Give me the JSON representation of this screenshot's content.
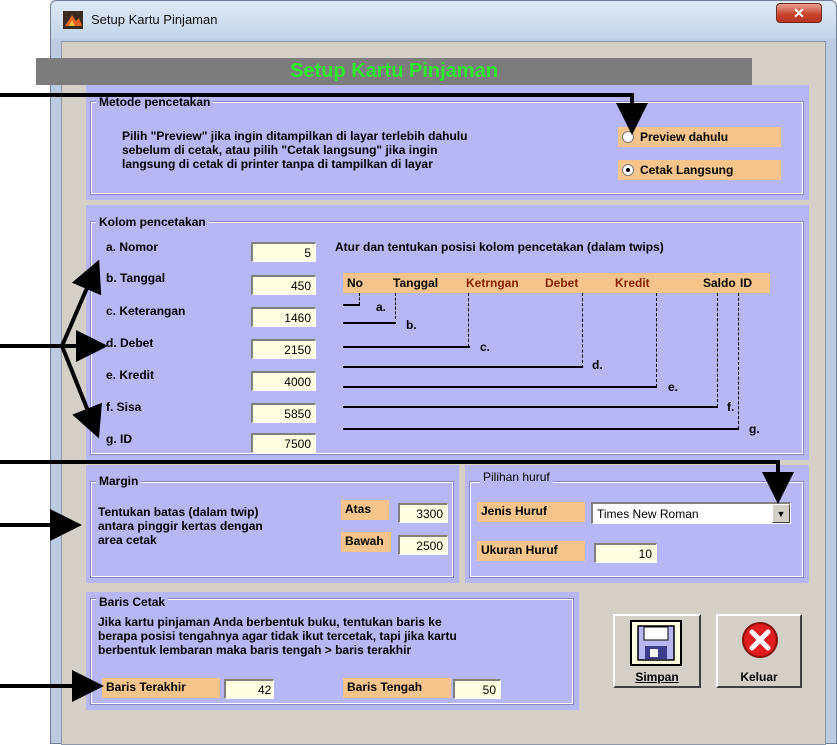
{
  "window": {
    "title": "Setup Kartu Pinjaman"
  },
  "header": {
    "title": "Setup Kartu Pinjaman"
  },
  "metode": {
    "title": "Metode pencetakan",
    "description_lines": [
      "Pilih \"Preview\" jika ingin ditampilkan di layar terlebih dahulu",
      "sebelum di cetak, atau pilih \"Cetak langsung\" jika ingin",
      "langsung di cetak di printer tanpa di tampilkan di layar"
    ],
    "options": [
      {
        "label": "Preview dahulu",
        "selected": false
      },
      {
        "label": "Cetak Langsung",
        "selected": true
      }
    ]
  },
  "kolom": {
    "title": "Kolom pencetakan",
    "instruction": "Atur dan tentukan posisi kolom pencetakan (dalam twips)",
    "fields": [
      {
        "label": "a. Nomor",
        "value": "5"
      },
      {
        "label": "b. Tanggal",
        "value": "450"
      },
      {
        "label": "c. Keterangan",
        "value": "1460"
      },
      {
        "label": "d. Debet",
        "value": "2150"
      },
      {
        "label": "e. Kredit",
        "value": "4000"
      },
      {
        "label": "f. Sisa",
        "value": "5850"
      },
      {
        "label": "g. ID",
        "value": "7500"
      }
    ],
    "column_headers": [
      "No",
      "Tanggal",
      "Ketrngan",
      "Debet",
      "Kredit",
      "Saldo",
      "ID"
    ],
    "markers": [
      "a.",
      "b.",
      "c.",
      "d.",
      "e.",
      "f.",
      "g."
    ]
  },
  "margin": {
    "title": "Margin",
    "description_lines": [
      "Tentukan batas (dalam twip)",
      "antara pinggir kertas dengan",
      "area cetak"
    ],
    "atas_label": "Atas",
    "atas_value": "3300",
    "bawah_label": "Bawah",
    "bawah_value": "2500"
  },
  "huruf": {
    "title": "Pilihan huruf",
    "jenis_label": "Jenis Huruf",
    "jenis_value": "Times New Roman",
    "ukuran_label": "Ukuran Huruf",
    "ukuran_value": "10"
  },
  "baris": {
    "title": "Baris Cetak",
    "description_lines": [
      "Jika kartu pinjaman Anda berbentuk buku, tentukan baris ke",
      "berapa posisi tengahnya agar tidak ikut tercetak, tapi jika kartu",
      "berbentuk lembaran maka baris tengah > baris terakhir"
    ],
    "terakhir_label": "Baris Terakhir",
    "terakhir_value": "42",
    "tengah_label": "Baris Tengah",
    "tengah_value": "50"
  },
  "buttons": {
    "simpan": "Simpan",
    "keluar": "Keluar"
  },
  "colors": {
    "panel": "#b7b7f6",
    "accent_orange": "#f7c58c",
    "header_green": "#2cf02c",
    "textbox": "#ffffe1"
  }
}
